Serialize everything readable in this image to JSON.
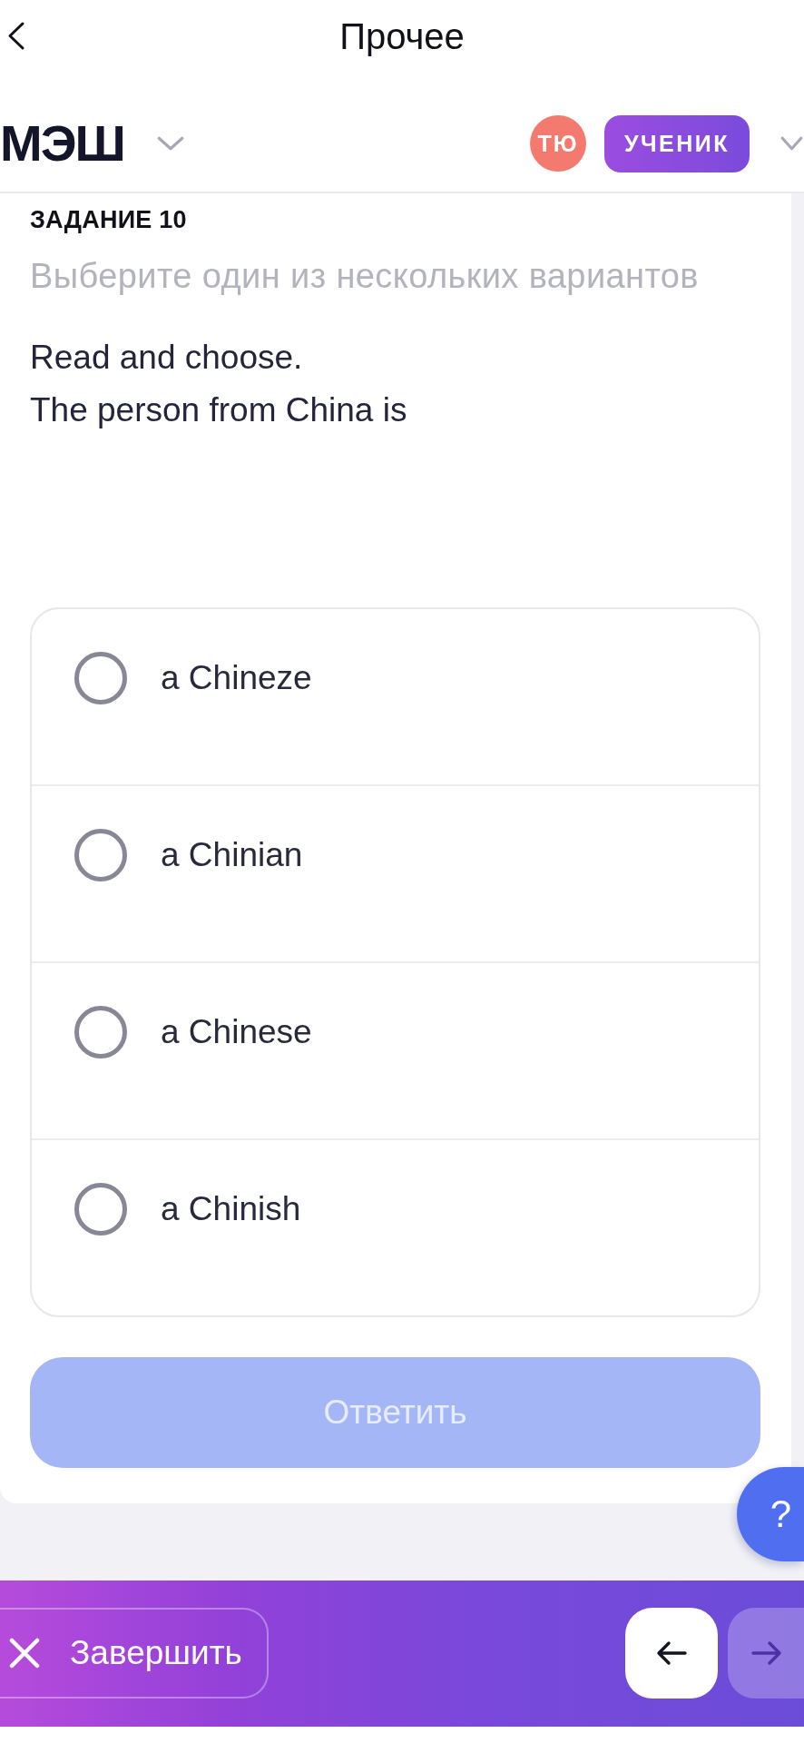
{
  "header": {
    "title": "Прочее"
  },
  "topbar": {
    "logo": "МЭШ",
    "avatar_initials": "ТЮ",
    "role": "УЧЕНИК"
  },
  "task": {
    "number": "ЗАДАНИЕ 10",
    "instruction": "Выберите один из нескольких вариантов",
    "question_lines": [
      "Read and choose.",
      "The person from China is"
    ]
  },
  "options": [
    {
      "label": "a Chineze",
      "selected": false
    },
    {
      "label": "a Chinian",
      "selected": false
    },
    {
      "label": "a Chinese",
      "selected": false
    },
    {
      "label": "a Chinish",
      "selected": false
    }
  ],
  "answer_button": {
    "label": "Ответить",
    "disabled": true
  },
  "help_button": {
    "label": "?"
  },
  "footer": {
    "finish_button": {
      "label": "Завершить"
    },
    "prev_button": {
      "disabled": false
    },
    "next_button": {
      "disabled": true
    }
  }
}
